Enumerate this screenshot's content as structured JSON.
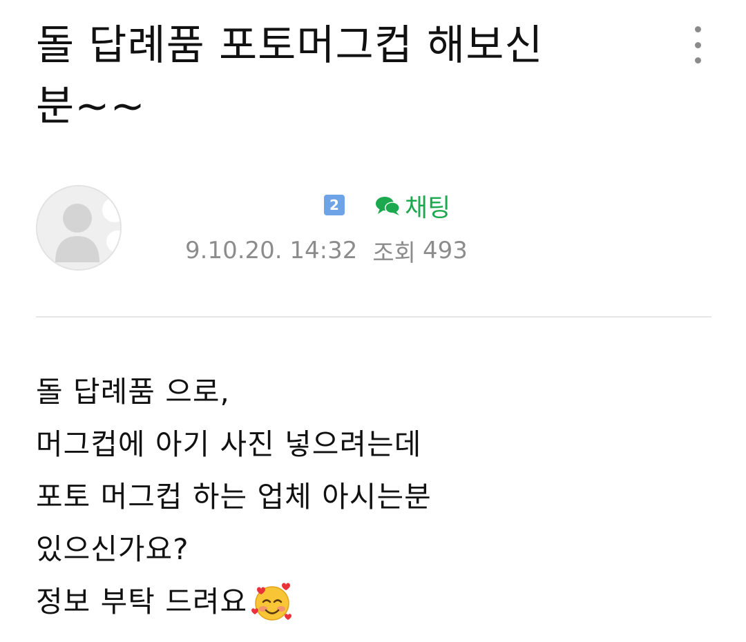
{
  "post": {
    "title_line1": "돌 답례품 포토머그컵 해보신",
    "title_line2": "분~~"
  },
  "author": {
    "badge": "2",
    "chat_label": "채팅",
    "date": "9.10.20. 14:32",
    "views_label": "조회",
    "views_count": "493"
  },
  "content": {
    "lines": [
      "돌 답례품 으로,",
      "머그컵에 아기 사진 넣으려는데",
      "포토 머그컵 하는 업체 아시는분",
      "있으신가요?",
      "정보 부탁 드려요"
    ],
    "trailing_emoji": "smiling-face-with-hearts-icon"
  },
  "colors": {
    "chat_green": "#1ba84e",
    "meta_gray": "#8c8c8c",
    "badge_blue": "#6fa3e8"
  },
  "icons": {
    "more": "more-vertical-icon",
    "chat": "chat-bubble-icon",
    "avatar": "default-avatar-icon"
  }
}
